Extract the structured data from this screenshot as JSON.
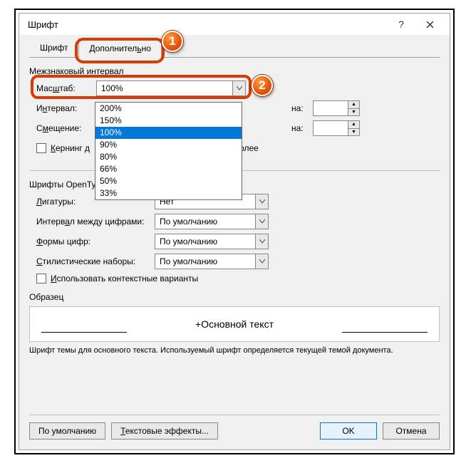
{
  "window": {
    "title": "Шрифт"
  },
  "tabs": {
    "font": "Шрифт",
    "advanced": "Дополнительно"
  },
  "spacing": {
    "group_title": "Межзнаковый интервал",
    "scale_label": "Масштаб:",
    "scale_value": "100%",
    "interval_label": "Интервал:",
    "na_label": "на:",
    "offset_label": "Смещение:",
    "kerning_label": "Кернинг д",
    "kerning_suffix": "пунктов и более"
  },
  "scale_options": [
    "200%",
    "150%",
    "100%",
    "90%",
    "80%",
    "66%",
    "50%",
    "33%"
  ],
  "scale_selected": "100%",
  "opentype": {
    "group_title": "Шрифты OpenType",
    "ligatures_label": "Лигатуры:",
    "ligatures_value": "Нет",
    "num_spacing_label": "Интервал между цифрами:",
    "num_forms_label": "Формы цифр:",
    "styl_sets_label": "Стилистические наборы:",
    "default_value": "По умолчанию",
    "contextual_label": "Использовать контекстные варианты"
  },
  "preview": {
    "group_title": "Образец",
    "sample_text": "+Основной текст",
    "footnote": "Шрифт темы для основного текста. Используемый шрифт определяется текущей темой документа."
  },
  "buttons": {
    "default": "По умолчанию",
    "text_effects": "Текстовые эффекты...",
    "ok": "OK",
    "cancel": "Отмена"
  },
  "badges": {
    "one": "1",
    "two": "2"
  }
}
